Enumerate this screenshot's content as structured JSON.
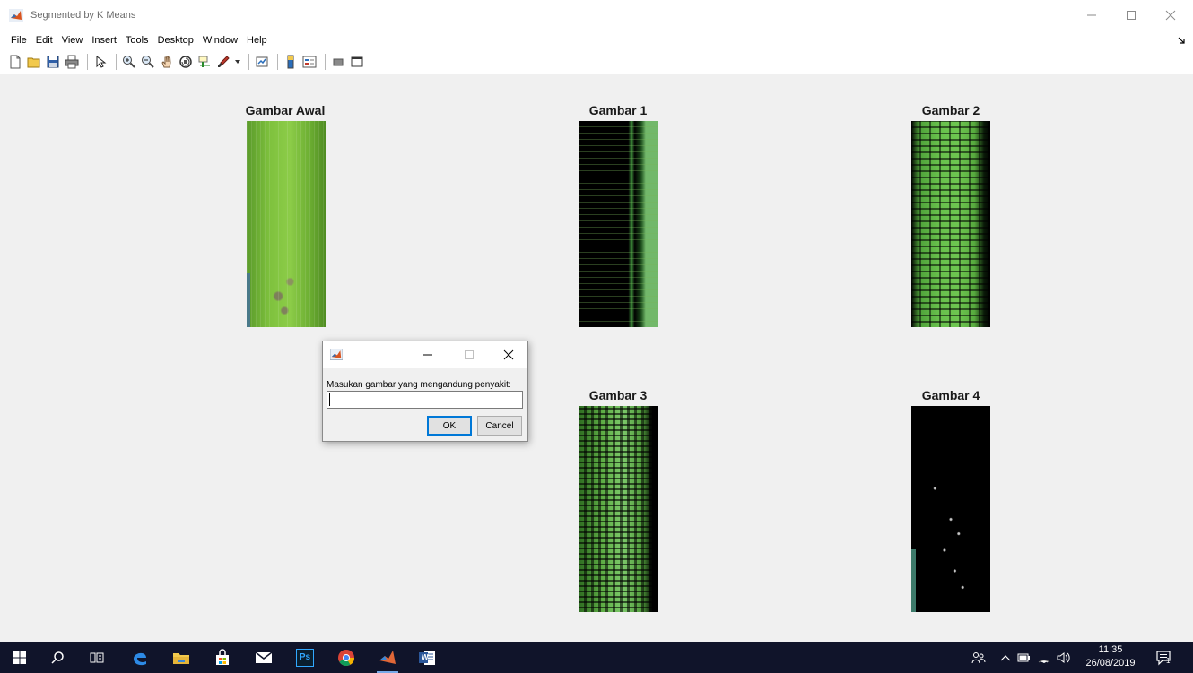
{
  "window": {
    "title": "Segmented by K Means"
  },
  "menu": {
    "items": [
      "File",
      "Edit",
      "View",
      "Insert",
      "Tools",
      "Desktop",
      "Window",
      "Help"
    ]
  },
  "toolbar": {
    "icons": [
      "new-figure-icon",
      "open-file-icon",
      "save-icon",
      "print-icon",
      "edit-plot-icon",
      "zoom-in-icon",
      "zoom-out-icon",
      "pan-icon",
      "rotate-3d-icon",
      "data-cursor-icon",
      "brush-icon",
      "link-plot-icon",
      "colorbar-icon",
      "legend-icon",
      "hide-plot-tools-icon",
      "show-plot-tools-icon"
    ]
  },
  "figure": {
    "panels": [
      {
        "title": "Gambar Awal"
      },
      {
        "title": "Gambar 1"
      },
      {
        "title": "Gambar 2"
      },
      {
        "title": "Gambar 3"
      },
      {
        "title": "Gambar 4"
      }
    ],
    "colors": {
      "background": "#f0f0f0",
      "leaf_green": "#7fc23e",
      "segment_black": "#000000"
    }
  },
  "dialog": {
    "prompt": "Masukan gambar yang mengandung penyakit:",
    "input_value": "",
    "ok_label": "OK",
    "cancel_label": "Cancel"
  },
  "taskbar": {
    "apps": [
      "start-icon",
      "search-icon",
      "task-view-icon",
      "edge-icon",
      "file-explorer-icon",
      "store-icon",
      "mail-icon",
      "photoshop-icon",
      "chrome-icon",
      "matlab-icon",
      "word-icon"
    ],
    "photoshop_label": "Ps",
    "word_label": "W",
    "time": "11:35",
    "date": "26/08/2019",
    "notification_count": "1"
  }
}
